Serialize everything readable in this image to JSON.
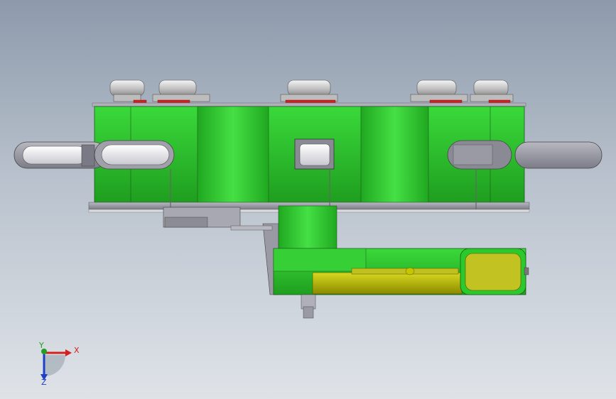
{
  "viewport": {
    "background_top": "#8d9aab",
    "background_bottom": "#dfe3e8",
    "model": {
      "body_color": "#2fcf2f",
      "body_dark_color": "#1fa51f",
      "body_light_color": "#4fe24f",
      "grey_color": "#9a9aa6",
      "yellow_color": "#c8c800",
      "red_detail_color": "#cc2222"
    }
  },
  "triad": {
    "x_label": "X",
    "y_label": "Y",
    "z_label": "Z",
    "x_color": "#d42020",
    "y_color": "#20a020",
    "z_color": "#1e3fc8"
  }
}
